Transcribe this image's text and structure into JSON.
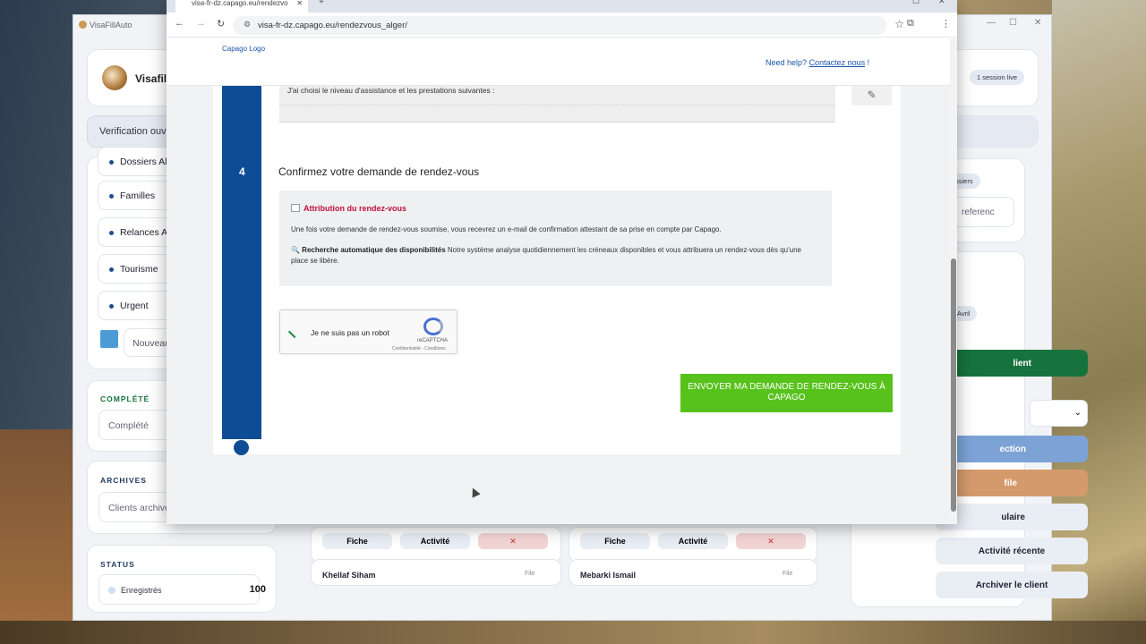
{
  "app": {
    "window_title": "VisaFillAuto",
    "brand": "VisafillA",
    "verification": "Verification ouve",
    "sidebar_items": [
      "Dossiers Al",
      "Familles",
      "Relances Av",
      "Tourisme",
      "Urgent"
    ],
    "new_placeholder": "Nouveau",
    "complete": {
      "heading": "COMPLÉTÉ",
      "box": "Complété"
    },
    "archives": {
      "heading": "ARCHIVES",
      "box": "Clients archive"
    },
    "status": {
      "heading": "STATUS",
      "label": "Enregistrés",
      "count": "100"
    },
    "right": {
      "session_pill": "1 session live",
      "dossiers_pill": "ssiers",
      "ref_placeholder": "referenc",
      "avril_pill": "Avril",
      "buttons": [
        "lient",
        "ection",
        "file",
        "ulaire",
        "Activité récente",
        "Archiver le client"
      ]
    },
    "bottom_cards": [
      {
        "name": "Khellaf Siham",
        "actions": [
          "Fiche",
          "Activité",
          "✕"
        ],
        "flag": "File"
      },
      {
        "name": "Mebarki Ismail",
        "actions": [
          "Fiche",
          "Activité",
          "✕"
        ],
        "flag": "File"
      }
    ],
    "colors": {
      "primary": "#1f4f8a",
      "green": "#17733d",
      "accent_blue": "#7da3d6",
      "accent_orange": "#d59a6c"
    }
  },
  "browser": {
    "tab_title": "visa-fr-dz.capago.eu/rendezvo",
    "url": "visa-fr-dz.capago.eu/rendezvous_alger/",
    "logo_alt": "Capago Logo",
    "help_text": "Need help?",
    "help_link": "Contactez nous",
    "help_suffix": "!",
    "prev_text": "J'ai choisi le niveau d'assistance et les prestations suivantes :",
    "step_number": "4",
    "step_title": "Confirmez votre demande de rendez-vous",
    "info_title": "Attribution du rendez-vous",
    "info_text": "Une fois votre demande de rendez-vous soumise, vous recevrez un e-mail de confirmation attestant de sa prise en compte par Capago.",
    "info_bold": "🔍 Recherche automatique des disponibilités",
    "info_rest": " Notre système analyse quotidiennement les créneaux disponibles et vous attribuera un rendez-vous dès qu'une place se libère.",
    "recaptcha_label": "Je ne suis pas un robot",
    "recaptcha_brand": "reCAPTCHA",
    "recaptcha_links": "Confidentialité - Conditions",
    "submit": "ENVOYER MA DEMANDE DE RENDEZ-VOUS À CAPAGO",
    "colors": {
      "rail": "#0e4d96",
      "submit": "#58c21c",
      "info_title": "#c0133a"
    }
  }
}
